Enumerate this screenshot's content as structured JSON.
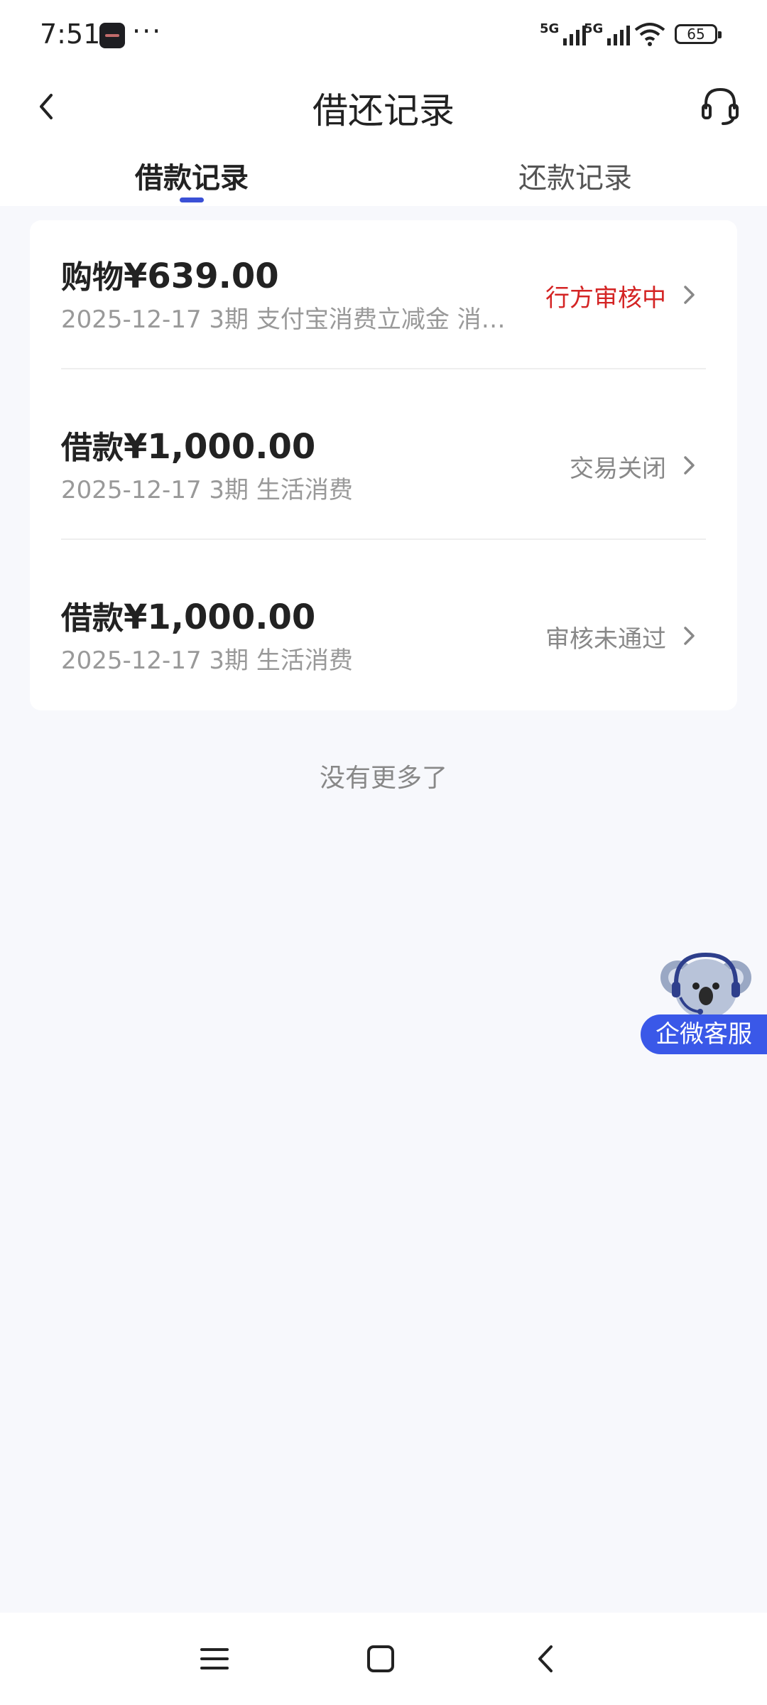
{
  "status_bar": {
    "time": "7:51",
    "more": "···",
    "signal_1": "5G",
    "signal_2": "5G",
    "battery": "65"
  },
  "header": {
    "title": "借还记录",
    "back_icon": "chevron-left-icon",
    "service_icon": "headset-icon"
  },
  "tabs": [
    {
      "label": "借款记录",
      "active": true
    },
    {
      "label": "还款记录",
      "active": false
    }
  ],
  "records": [
    {
      "type": "购物",
      "amount": "¥639.00",
      "subtitle": "2025-12-17 3期  支付宝消费立减金 消…",
      "status": "行方审核中",
      "status_color": "#d42424"
    },
    {
      "type": "借款",
      "amount": "¥1,000.00",
      "subtitle": "2025-12-17 3期  生活消费",
      "status": "交易关闭",
      "status_color": "#888888"
    },
    {
      "type": "借款",
      "amount": "¥1,000.00",
      "subtitle": "2025-12-17 3期  生活消费",
      "status": "审核未通过",
      "status_color": "#888888"
    }
  ],
  "footer_text": "没有更多了",
  "float_service": {
    "label": "企微客服",
    "icon": "koala-mascot-icon"
  },
  "colors": {
    "accent": "#3a50d6",
    "warning": "#d42424",
    "float_bg": "#3a58e8"
  },
  "nav_bar": {
    "menu_icon": "menu-icon",
    "home_icon": "home-square-icon",
    "back_icon": "back-icon"
  }
}
